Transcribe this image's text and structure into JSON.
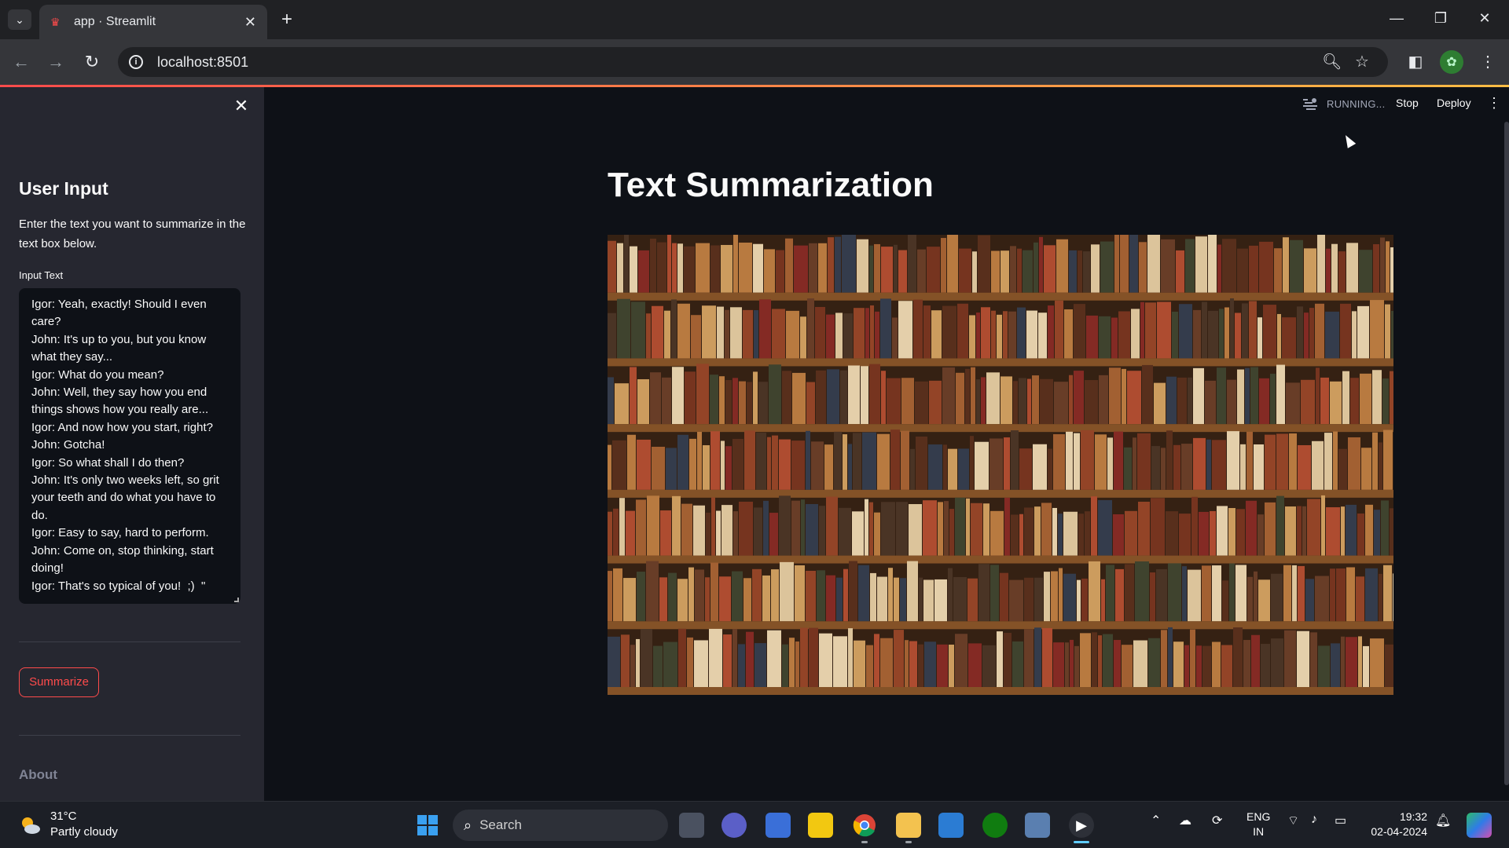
{
  "browser": {
    "tab_title": "app · Streamlit",
    "url": "localhost:8501"
  },
  "header": {
    "status": "RUNNING...",
    "stop_label": "Stop",
    "deploy_label": "Deploy"
  },
  "sidebar": {
    "heading": "User Input",
    "description": "Enter the text you want to summarize in the text box below.",
    "input_label": "Input Text",
    "input_lines": [
      "Igor: Yeah, exactly! Should I even",
      "care?",
      "John: It's up to you, but you know",
      "what they say...",
      "Igor: What do you mean?",
      "John: Well, they say how you end",
      "things shows how you really are...",
      "Igor: And now how you start, right?",
      "John: Gotcha!",
      "Igor: So what shall I do then?",
      "John: It's only two weeks left, so grit",
      "your teeth and do what you have to",
      "do.",
      "Igor: Easy to say, hard to perform.",
      "John: Come on, stop thinking, start",
      "doing!",
      "Igor: That's so typical of you!  ;)  \""
    ],
    "button_label": "Summarize",
    "about_label": "About"
  },
  "main": {
    "title": "Text Summarization",
    "image_name": "bookshelf-image"
  },
  "taskbar": {
    "weather_temp": "31°C",
    "weather_condition": "Partly cloudy",
    "search_label": "Search",
    "lang_top": "ENG",
    "lang_bottom": "IN",
    "time": "19:32",
    "date": "02-04-2024"
  },
  "colors": {
    "accent": "#ff4b4b",
    "sidebar_bg": "#262730",
    "main_bg": "#0e1117"
  }
}
